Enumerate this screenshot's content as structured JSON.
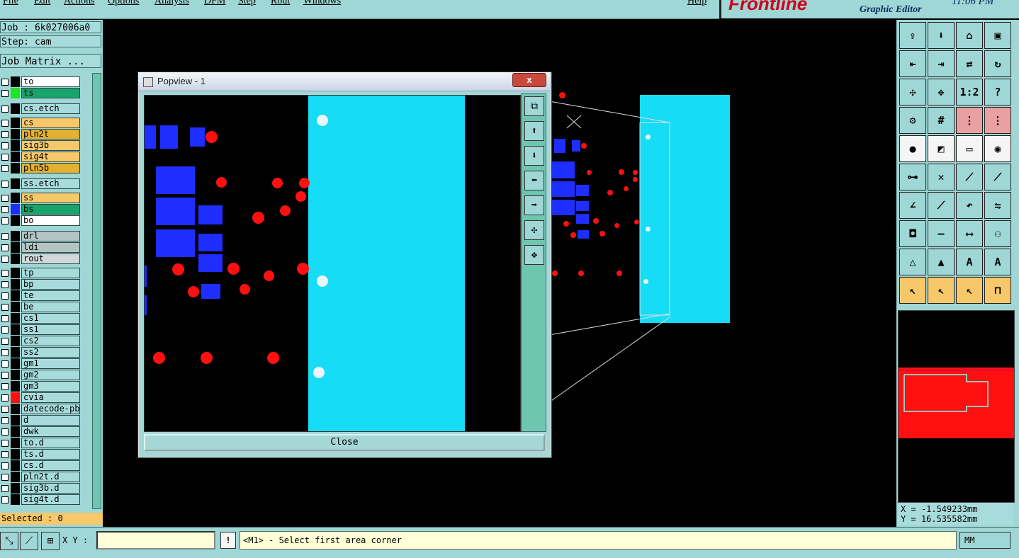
{
  "menu": [
    "File",
    "Edit",
    "Actions",
    "Options",
    "Analysis",
    "DFM",
    "Step",
    "Rout",
    "Windows"
  ],
  "help_label": "Help",
  "brand": {
    "logo": "Frontline",
    "subtitle": "Graphic Editor",
    "clock": "11:06 PM"
  },
  "job": {
    "job_line": "Job : 6k027006a0",
    "step_line": "Step: cam",
    "matrix_label": "Job Matrix ..."
  },
  "layers": [
    {
      "name": "to",
      "color": "#ffffff",
      "swatch": "#000000"
    },
    {
      "name": "ts",
      "color": "#19a46a",
      "swatch": "#1ee61e"
    },
    {
      "name": "cs.etch",
      "color": "#a8dcdc",
      "swatch": "#000000"
    },
    {
      "name": "cs",
      "color": "#f7c86a",
      "swatch": "#000000"
    },
    {
      "name": "pln2t",
      "color": "#e3b030",
      "swatch": "#000000"
    },
    {
      "name": "sig3b",
      "color": "#f7c86a",
      "swatch": "#000000"
    },
    {
      "name": "sig4t",
      "color": "#f7c86a",
      "swatch": "#000000"
    },
    {
      "name": "pln5b",
      "color": "#e3b030",
      "swatch": "#000000"
    },
    {
      "name": "ss.etch",
      "color": "#a8dcdc",
      "swatch": "#000000"
    },
    {
      "name": "ss",
      "color": "#f7c86a",
      "swatch": "#000000"
    },
    {
      "name": "bs",
      "color": "#19a46a",
      "swatch": "#1e2eff"
    },
    {
      "name": "bo",
      "color": "#ffffff",
      "swatch": "#000000"
    },
    {
      "name": "drl",
      "color": "#b4c4c4",
      "swatch": "#000000"
    },
    {
      "name": "ldi",
      "color": "#b4c4c4",
      "swatch": "#000000"
    },
    {
      "name": "rout",
      "color": "#d0d8d8",
      "swatch": "#000000"
    },
    {
      "name": "tp",
      "color": "#a8dcdc",
      "swatch": "#000000"
    },
    {
      "name": "bp",
      "color": "#a8dcdc",
      "swatch": "#000000"
    },
    {
      "name": "te",
      "color": "#a8dcdc",
      "swatch": "#000000"
    },
    {
      "name": "be",
      "color": "#a8dcdc",
      "swatch": "#000000"
    },
    {
      "name": "cs1",
      "color": "#a8dcdc",
      "swatch": "#000000"
    },
    {
      "name": "ss1",
      "color": "#a8dcdc",
      "swatch": "#000000"
    },
    {
      "name": "cs2",
      "color": "#a8dcdc",
      "swatch": "#000000"
    },
    {
      "name": "ss2",
      "color": "#a8dcdc",
      "swatch": "#000000"
    },
    {
      "name": "gm1",
      "color": "#a8dcdc",
      "swatch": "#000000"
    },
    {
      "name": "gm2",
      "color": "#a8dcdc",
      "swatch": "#000000"
    },
    {
      "name": "gm3",
      "color": "#a8dcdc",
      "swatch": "#000000"
    },
    {
      "name": "cvia",
      "color": "#a8dcdc",
      "swatch": "#ff1010"
    },
    {
      "name": "datecode-pbe",
      "color": "#a8dcdc",
      "swatch": "#000000"
    },
    {
      "name": "d",
      "color": "#a8dcdc",
      "swatch": "#000000"
    },
    {
      "name": "dwk",
      "color": "#a8dcdc",
      "swatch": "#000000"
    },
    {
      "name": "to.d",
      "color": "#a8dcdc",
      "swatch": "#000000"
    },
    {
      "name": "ts.d",
      "color": "#a8dcdc",
      "swatch": "#000000"
    },
    {
      "name": "cs.d",
      "color": "#a8dcdc",
      "swatch": "#000000"
    },
    {
      "name": "pln2t.d",
      "color": "#a8dcdc",
      "swatch": "#000000"
    },
    {
      "name": "sig3b.d",
      "color": "#a8dcdc",
      "swatch": "#000000"
    },
    {
      "name": "sig4t.d",
      "color": "#a8dcdc",
      "swatch": "#000000"
    }
  ],
  "selected_label": "Selected : 0",
  "popview": {
    "title": "Popview - 1",
    "close_x": "x",
    "close_button": "Close"
  },
  "coordinates": {
    "x": "X = -1.549233mm",
    "y": "Y = 16.535582mm"
  },
  "status": {
    "xy_label": "X Y :",
    "message": "<M1> - Select first area corner",
    "units": "MM",
    "warn": "!"
  },
  "colors": {
    "panel": "#9fd6d6",
    "copper_fill": "#16dcf5",
    "pad_blue": "#1e2eff",
    "via_red": "#ff1010",
    "highlight_yellow": "#f7c86a"
  }
}
